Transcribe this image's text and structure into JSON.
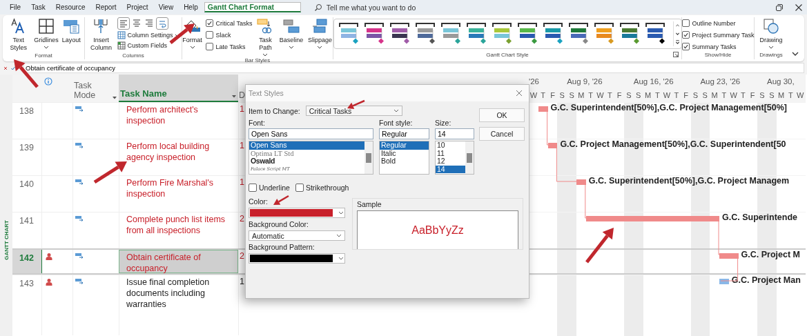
{
  "menu": {
    "tabs": [
      {
        "label": "File",
        "selected": false
      },
      {
        "label": "Task",
        "selected": false
      },
      {
        "label": "Resource",
        "selected": false
      },
      {
        "label": "Report",
        "selected": false
      },
      {
        "label": "Project",
        "selected": false
      },
      {
        "label": "View",
        "selected": false
      },
      {
        "label": "Help",
        "selected": false
      },
      {
        "label": "Gantt Chart Format",
        "selected": true
      }
    ],
    "search": {
      "placeholder": "Tell me what you want to do"
    }
  },
  "ribbon": {
    "format": {
      "label": "Format",
      "buttons": [
        "Text Styles",
        "Gridlines",
        "Layout"
      ]
    },
    "columns": {
      "label": "Columns",
      "insert": "Insert Column",
      "settings": "Column Settings",
      "custom_fields": "Custom Fields"
    },
    "bar_styles": {
      "label": "Bar Styles",
      "format": "Format",
      "checks": [
        {
          "label": "Critical Tasks",
          "checked": true
        },
        {
          "label": "Slack",
          "checked": false
        },
        {
          "label": "Late Tasks",
          "checked": false
        }
      ],
      "buttons": [
        "Task Path",
        "Baseline",
        "Slippage"
      ]
    },
    "gantt_style": {
      "label": "Gantt Chart Style",
      "styles": [
        {
          "color": "#79c6d8",
          "lower_bar": {
            "color": "#8fb4e3"
          },
          "marker": {
            "color": "#1aa2c0"
          }
        },
        {
          "color": "#d6338a",
          "lower_bar": {
            "color": "#7b55a6"
          },
          "marker": {
            "color": "#d6338a"
          }
        },
        {
          "color": "#a05ca8",
          "lower_bar": {
            "color": "#3a3550"
          },
          "marker": {
            "color": "#a05ca8"
          }
        },
        {
          "color": "#9a9a9a",
          "lower_bar": {
            "color": "#4f6a9a"
          },
          "marker": {
            "color": "#555555"
          }
        },
        {
          "color": "#79c6d8",
          "lower_bar": {
            "color": "#9a9a9a"
          },
          "marker": {
            "color": "#2aa49a"
          }
        },
        {
          "color": "#3ab39a",
          "lower_bar": {
            "color": "#2a7ab8"
          },
          "marker": {
            "color": "#2aa49a"
          }
        },
        {
          "color": "#a8c83a",
          "lower_bar": {
            "color": "#79c6d8"
          },
          "marker": {
            "color": "#7aa030"
          }
        },
        {
          "color": "#58b84a",
          "lower_bar": {
            "color": "#2a5ab0"
          },
          "marker": {
            "color": "#3a9a40"
          }
        },
        {
          "color": "#1a9aa8",
          "lower_bar": {
            "color": "#2a5ab0"
          },
          "marker": {
            "color": "#1aa2c0"
          }
        },
        {
          "color": "#1e7a3a",
          "lower_bar": {
            "color": "#4a6ab8"
          },
          "marker": {
            "color": "#888888"
          }
        },
        {
          "color": "#f0a020",
          "lower_bar": {
            "color": "#e88a20"
          },
          "marker": {
            "color": "#d89a20"
          }
        },
        {
          "color": "#4a7a30",
          "lower_bar": {
            "color": "#1a7a9a"
          },
          "marker": {
            "color": "#5a9a30"
          }
        },
        {
          "color": "#2a5ab0",
          "lower_bar": {
            "color": "#2a5ab0"
          },
          "marker": {
            "color": "#000000"
          }
        }
      ]
    },
    "show_hide": {
      "label": "Show/Hide",
      "checks": [
        {
          "label": "Outline Number",
          "checked": false
        },
        {
          "label": "Project Summary Task",
          "checked": true
        },
        {
          "label": "Summary Tasks",
          "checked": true
        }
      ]
    },
    "drawings": {
      "label": "Drawings",
      "button": "Drawing"
    }
  },
  "entry_bar": {
    "value": "Obtain certificate of occupancy"
  },
  "sheet": {
    "side_label": "GANTT CHART",
    "columns": [
      {
        "label": "Task Mode",
        "selected": false
      },
      {
        "label": "Task Name",
        "selected": true
      },
      {
        "label": "D",
        "selected": false
      }
    ],
    "rows": [
      {
        "id": "138",
        "name": "Perform architect's inspection",
        "duration": "1",
        "critical": true,
        "resource_indicator": false,
        "selected": false,
        "bar_label": "G.C. Superintendent[50%],G.C. Project Management[50%]"
      },
      {
        "id": "139",
        "name": "Perform local building agency inspection",
        "duration": "1",
        "critical": true,
        "resource_indicator": false,
        "selected": false,
        "bar_label": "G.C. Project Management[50%],G.C. Superintendent[50"
      },
      {
        "id": "140",
        "name": "Perform Fire Marshal's inspection",
        "duration": "1",
        "critical": true,
        "resource_indicator": false,
        "selected": false,
        "bar_label": "G.C. Superintendent[50%],G.C. Project Managem"
      },
      {
        "id": "141",
        "name": "Complete punch list items from all inspections",
        "duration": "2",
        "critical": true,
        "resource_indicator": false,
        "selected": false,
        "bar_label": "G.C. Superintende"
      },
      {
        "id": "142",
        "name": "Obtain certificate of occupancy",
        "duration": "2",
        "critical": true,
        "resource_indicator": true,
        "selected": true,
        "bar_label": "G.C. Project M"
      },
      {
        "id": "143",
        "name": "Issue final completion documents including warranties",
        "duration": "1",
        "critical": false,
        "resource_indicator": true,
        "selected": false,
        "bar_label": "G.C. Project Man"
      }
    ]
  },
  "timeline": {
    "weeks": [
      "'26",
      "Aug 9, '26",
      "Aug 16, '26",
      "Aug 23, '26",
      "Aug 30,"
    ],
    "days": [
      {
        "label": "W",
        "weekend": false
      },
      {
        "label": "T",
        "weekend": false
      },
      {
        "label": "F",
        "weekend": false
      },
      {
        "label": "S",
        "weekend": true
      },
      {
        "label": "S",
        "weekend": true
      },
      {
        "label": "M",
        "weekend": false
      },
      {
        "label": "T",
        "weekend": false
      },
      {
        "label": "W",
        "weekend": false
      },
      {
        "label": "T",
        "weekend": false
      },
      {
        "label": "F",
        "weekend": false
      },
      {
        "label": "S",
        "weekend": true
      },
      {
        "label": "S",
        "weekend": true
      },
      {
        "label": "M",
        "weekend": false
      },
      {
        "label": "T",
        "weekend": false
      },
      {
        "label": "W",
        "weekend": false
      },
      {
        "label": "T",
        "weekend": false
      },
      {
        "label": "F",
        "weekend": false
      },
      {
        "label": "S",
        "weekend": true
      },
      {
        "label": "S",
        "weekend": true
      },
      {
        "label": "M",
        "weekend": false
      },
      {
        "label": "T",
        "weekend": false
      },
      {
        "label": "W",
        "weekend": false
      },
      {
        "label": "T",
        "weekend": false
      },
      {
        "label": "F",
        "weekend": false
      },
      {
        "label": "S",
        "weekend": true
      },
      {
        "label": "S",
        "weekend": true
      },
      {
        "label": "M",
        "weekend": false
      },
      {
        "label": "T",
        "weekend": false
      },
      {
        "label": "W",
        "weekend": false
      }
    ]
  },
  "dialog": {
    "title": "Text Styles",
    "item_to_change": {
      "label": "Item to Change:",
      "value": "Critical Tasks"
    },
    "font": {
      "label": "Font:",
      "value": "Open Sans",
      "options": [
        {
          "label": "Open Sans",
          "kind": "sans",
          "selected": true
        },
        {
          "label": "Optima LT Std",
          "kind": "serif",
          "selected": false
        },
        {
          "label": "Oswald",
          "kind": "bold",
          "selected": false
        },
        {
          "label": "Palace Script MT",
          "kind": "script",
          "selected": false
        }
      ]
    },
    "font_style": {
      "label": "Font style:",
      "value": "Regular",
      "options": [
        {
          "label": "Regular",
          "selected": true
        },
        {
          "label": "Italic",
          "selected": false
        },
        {
          "label": "Bold",
          "selected": false
        }
      ]
    },
    "size": {
      "label": "Size:",
      "value": "14",
      "options": [
        {
          "label": "10",
          "selected": false
        },
        {
          "label": "11",
          "selected": false
        },
        {
          "label": "12",
          "selected": false
        },
        {
          "label": "14",
          "selected": true
        }
      ]
    },
    "underline": {
      "label": "Underline",
      "checked": false
    },
    "strikethrough": {
      "label": "Strikethrough",
      "checked": false
    },
    "color": {
      "label": "Color:",
      "color": "#c8202a"
    },
    "background_color": {
      "label": "Background Color:",
      "value": "Automatic"
    },
    "background_pattern": {
      "label": "Background Pattern:",
      "color": "#000000"
    },
    "sample": {
      "label": "Sample",
      "text": "AaBbYyZz"
    },
    "buttons": [
      "OK",
      "Cancel"
    ]
  }
}
